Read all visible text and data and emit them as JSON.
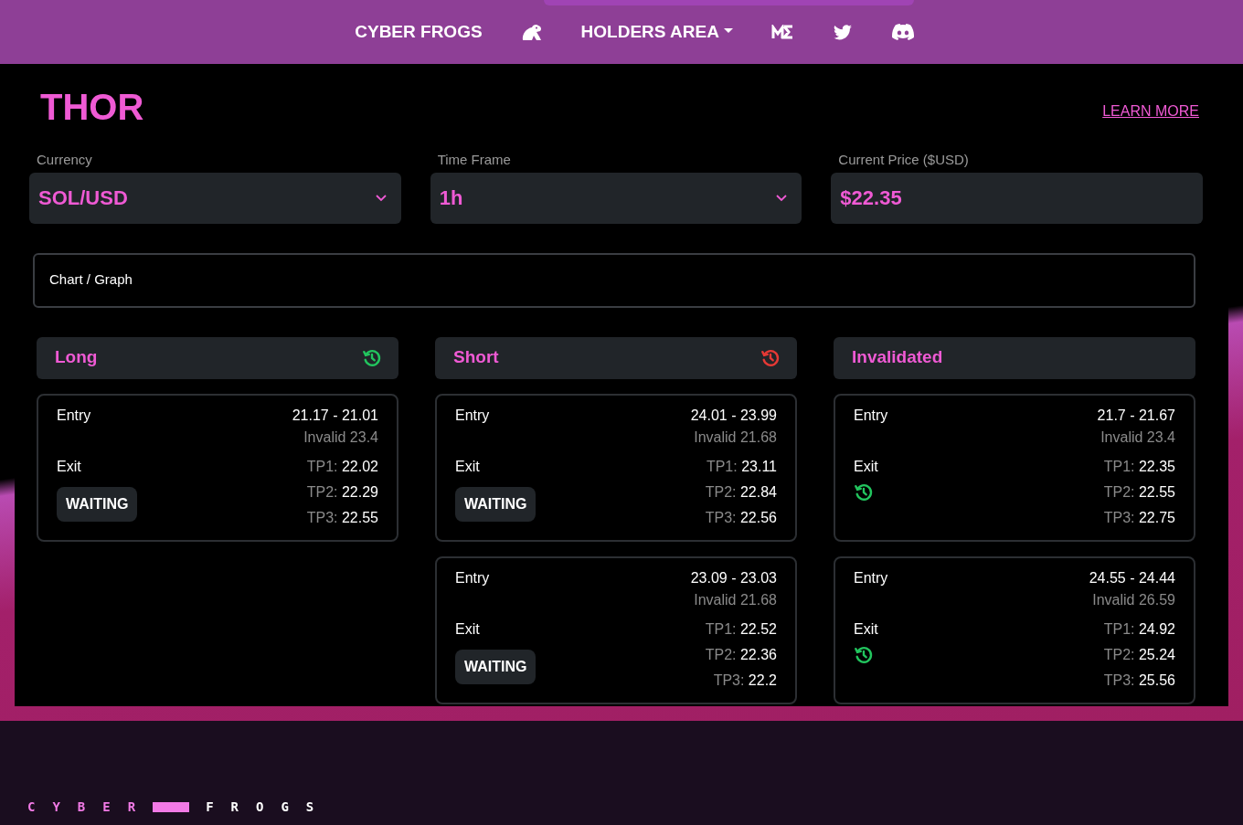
{
  "navbar": {
    "items": [
      {
        "kind": "text",
        "label": "CYBER FROGS"
      },
      {
        "kind": "icon"
      },
      {
        "kind": "dropdown",
        "label": "HOLDERS AREA"
      },
      {
        "kind": "icon"
      },
      {
        "kind": "icon"
      },
      {
        "kind": "icon"
      }
    ]
  },
  "page": {
    "title": "THOR",
    "link": "LEARN MORE"
  },
  "fields": [
    {
      "kind": "select",
      "label": "Currency",
      "value": "SOL/USD"
    },
    {
      "kind": "select",
      "label": "Time Frame",
      "value": "1h"
    },
    {
      "kind": "display",
      "label": "Current Price ($USD)",
      "value": "$22.35"
    }
  ],
  "chart_panel": {
    "label": "Chart / Graph"
  },
  "columns": [
    {
      "title": "Long",
      "color": "#22c55e",
      "trades": [
        {
          "entry_label": "Entry",
          "entry": "21.17 - 21.01",
          "invalid": "Invalid 23.4",
          "exit_label": "Exit",
          "status": {
            "kind": "badge",
            "label": "WAITING"
          },
          "targets": [
            {
              "label": "TP1:",
              "value": "22.02"
            },
            {
              "label": "TP2:",
              "value": "22.29"
            },
            {
              "label": "TP3:",
              "value": "22.55"
            }
          ]
        }
      ]
    },
    {
      "title": "Short",
      "color": "#e53935",
      "trades": [
        {
          "entry_label": "Entry",
          "entry": "24.01 - 23.99",
          "invalid": "Invalid 21.68",
          "exit_label": "Exit",
          "status": {
            "kind": "badge",
            "label": "WAITING"
          },
          "targets": [
            {
              "label": "TP1:",
              "value": "23.11"
            },
            {
              "label": "TP2:",
              "value": "22.84"
            },
            {
              "label": "TP3:",
              "value": "22.56"
            }
          ]
        },
        {
          "entry_label": "Entry",
          "entry": "23.09 - 23.03",
          "invalid": "Invalid 21.68",
          "exit_label": "Exit",
          "status": {
            "kind": "badge",
            "label": "WAITING"
          },
          "targets": [
            {
              "label": "TP1:",
              "value": "22.52"
            },
            {
              "label": "TP2:",
              "value": "22.36"
            },
            {
              "label": "TP3:",
              "value": "22.2"
            }
          ]
        }
      ]
    },
    {
      "title": "Invalidated",
      "trades": [
        {
          "entry_label": "Entry",
          "entry": "21.7 - 21.67",
          "invalid": "Invalid 23.4",
          "exit_label": "Exit",
          "status": {
            "kind": "icon",
            "color": "#22c55e"
          },
          "targets": [
            {
              "label": "TP1:",
              "value": "22.35"
            },
            {
              "label": "TP2:",
              "value": "22.55"
            },
            {
              "label": "TP3:",
              "value": "22.75"
            }
          ]
        },
        {
          "entry_label": "Entry",
          "entry": "24.55 - 24.44",
          "invalid": "Invalid 26.59",
          "exit_label": "Exit",
          "status": {
            "kind": "icon",
            "color": "#22c55e"
          },
          "targets": [
            {
              "label": "TP1:",
              "value": "24.92"
            },
            {
              "label": "TP2:",
              "value": "25.24"
            },
            {
              "label": "TP3:",
              "value": "25.56"
            }
          ]
        }
      ]
    }
  ],
  "footer": {
    "logo_left": "CYBER",
    "logo_right": "FROGS"
  }
}
